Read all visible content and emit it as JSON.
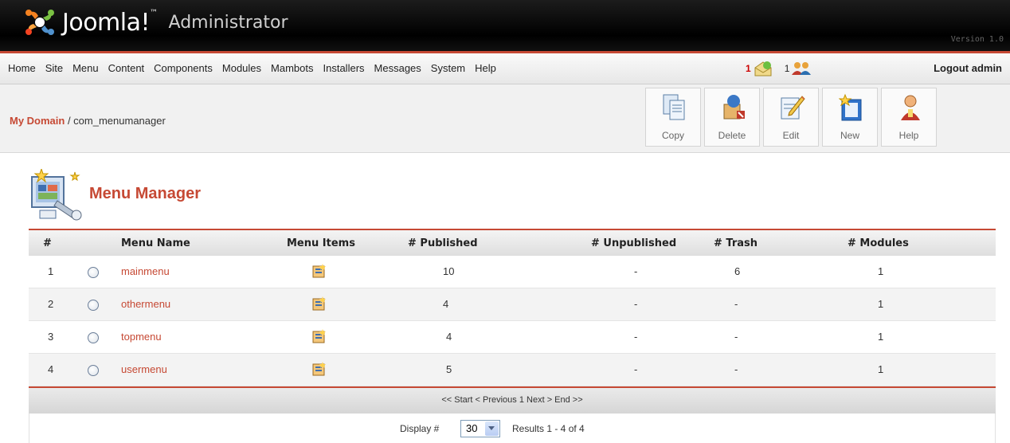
{
  "header": {
    "logo_text": "Joomla!",
    "trademark": "™",
    "subtitle": "Administrator",
    "version": "Version 1.0"
  },
  "menu": {
    "items": [
      "Home",
      "Site",
      "Menu",
      "Content",
      "Components",
      "Modules",
      "Mambots",
      "Installers",
      "Messages",
      "System",
      "Help"
    ],
    "messages_count": "1",
    "users_count": "1",
    "logout": "Logout admin"
  },
  "breadcrumb": {
    "site": "My Domain",
    "path": " / com_menumanager"
  },
  "toolbar": {
    "copy": "Copy",
    "delete": "Delete",
    "edit": "Edit",
    "new": "New",
    "help": "Help"
  },
  "page_title": "Menu Manager",
  "table": {
    "headers": {
      "num": "#",
      "menu_name": "Menu Name",
      "menu_items": "Menu Items",
      "published": "# Published",
      "unpublished": "# Unpublished",
      "trash": "# Trash",
      "modules": "# Modules"
    },
    "rows": [
      {
        "num": "1",
        "name": "mainmenu",
        "published": "10",
        "unpublished": "-",
        "trash": "6",
        "modules": "1"
      },
      {
        "num": "2",
        "name": "othermenu",
        "published": "4",
        "unpublished": "-",
        "trash": "-",
        "modules": "1"
      },
      {
        "num": "3",
        "name": "topmenu",
        "published": "4",
        "unpublished": "-",
        "trash": "-",
        "modules": "1"
      },
      {
        "num": "4",
        "name": "usermenu",
        "published": "5",
        "unpublished": "-",
        "trash": "-",
        "modules": "1"
      }
    ]
  },
  "pager": {
    "text": "<< Start < Previous 1 Next > End >>",
    "display_label": "Display #",
    "display_value": "30",
    "results": "Results 1 - 4 of 4"
  },
  "colors": {
    "accent": "#c64934",
    "header_bg": "#000000"
  }
}
